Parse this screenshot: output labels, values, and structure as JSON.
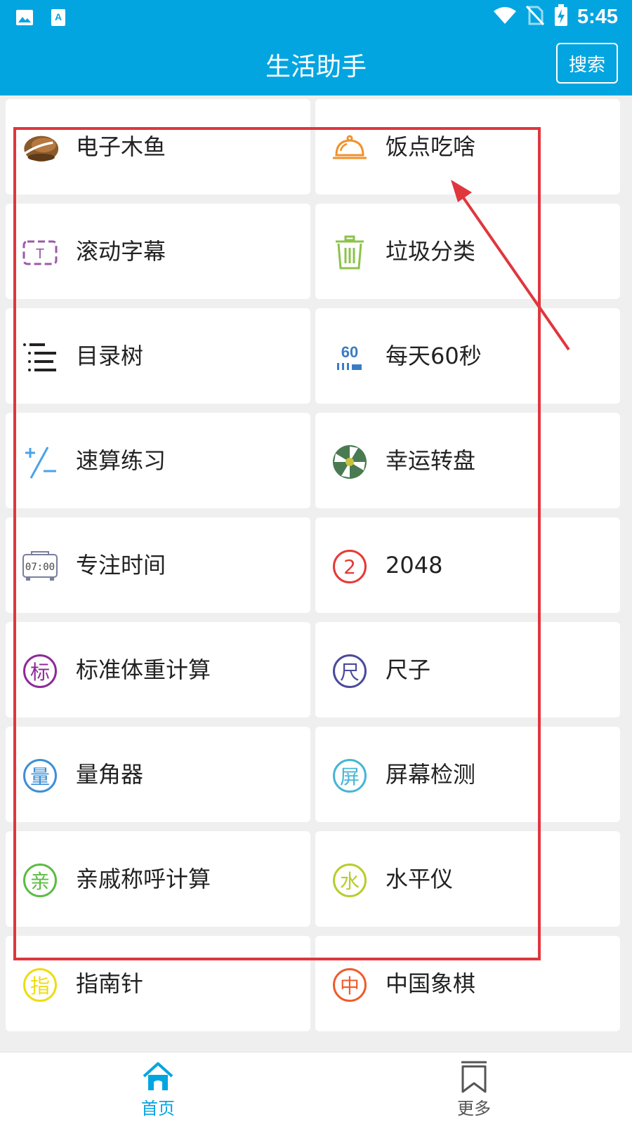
{
  "status_bar": {
    "time": "5:45"
  },
  "app_bar": {
    "title": "生活助手",
    "search_label": "搜索"
  },
  "tools": [
    {
      "label": "电子木鱼",
      "icon": "wooden-fish-icon"
    },
    {
      "label": "饭点吃啥",
      "icon": "dish-cloche-icon"
    },
    {
      "label": "滚动字幕",
      "icon": "scrolling-text-icon",
      "glyph": "T"
    },
    {
      "label": "垃圾分类",
      "icon": "trash-can-icon"
    },
    {
      "label": "目录树",
      "icon": "list-tree-icon"
    },
    {
      "label": "每天60秒",
      "icon": "sixty-seconds-icon",
      "glyph": "60"
    },
    {
      "label": "速算练习",
      "icon": "plus-minus-icon"
    },
    {
      "label": "幸运转盘",
      "icon": "lucky-wheel-icon"
    },
    {
      "label": "专注时间",
      "icon": "clock-icon",
      "glyph": "07:00"
    },
    {
      "label": "2048",
      "icon": "circle-2-icon",
      "glyph": "2",
      "color": "#e53935"
    },
    {
      "label": "标准体重计算",
      "icon": "circle-biao-icon",
      "glyph": "标",
      "color": "#8e2a9a"
    },
    {
      "label": "尺子",
      "icon": "circle-chi-icon",
      "glyph": "尺",
      "color": "#4a4a9c"
    },
    {
      "label": "量角器",
      "icon": "circle-liang-icon",
      "glyph": "量",
      "color": "#3d8fd6"
    },
    {
      "label": "屏幕检测",
      "icon": "circle-ping-icon",
      "glyph": "屏",
      "color": "#45b6d6"
    },
    {
      "label": "亲戚称呼计算",
      "icon": "circle-qin-icon",
      "glyph": "亲",
      "color": "#5cbc45"
    },
    {
      "label": "水平仪",
      "icon": "circle-shui-icon",
      "glyph": "水",
      "color": "#b8cd2c"
    },
    {
      "label": "指南针",
      "icon": "circle-zhi-icon",
      "glyph": "指",
      "color": "#eddc10"
    },
    {
      "label": "中国象棋",
      "icon": "circle-zhong-icon",
      "glyph": "中",
      "color": "#ef5b2b"
    }
  ],
  "bottom_nav": {
    "home_label": "首页",
    "more_label": "更多",
    "active_color": "#03a5e0",
    "inactive_color": "#555555"
  },
  "colors": {
    "primary": "#03a5e0",
    "annotation": "#e0363e"
  }
}
